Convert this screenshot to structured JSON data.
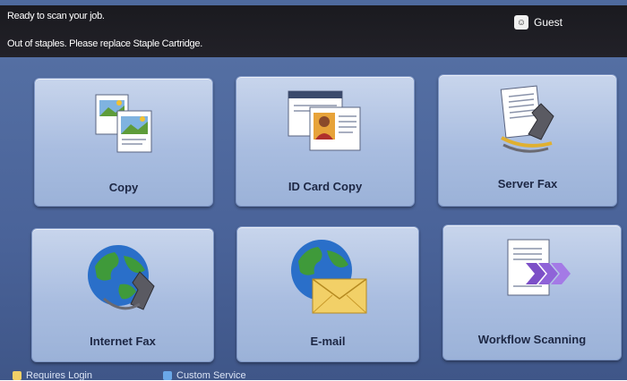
{
  "status": {
    "message_1": "Ready to scan your job.",
    "message_2": "Out of staples. Please replace Staple Cartridge."
  },
  "user": {
    "icon": "user-icon",
    "name": "Guest"
  },
  "services": [
    {
      "label": "Copy",
      "icon": "copy-icon"
    },
    {
      "label": "ID Card Copy",
      "icon": "id-card-icon"
    },
    {
      "label": "Server Fax",
      "icon": "server-fax-icon"
    },
    {
      "label": "Internet Fax",
      "icon": "internet-fax-icon"
    },
    {
      "label": "E-mail",
      "icon": "email-icon"
    },
    {
      "label": "Workflow Scanning",
      "icon": "workflow-scanning-icon"
    }
  ],
  "legend": {
    "requires_login": "Requires Login",
    "custom_service": "Custom Service"
  },
  "colors": {
    "panel": "#4e6a9e",
    "tile": "#b8c9e6",
    "status_bar": "#1c1b21"
  }
}
